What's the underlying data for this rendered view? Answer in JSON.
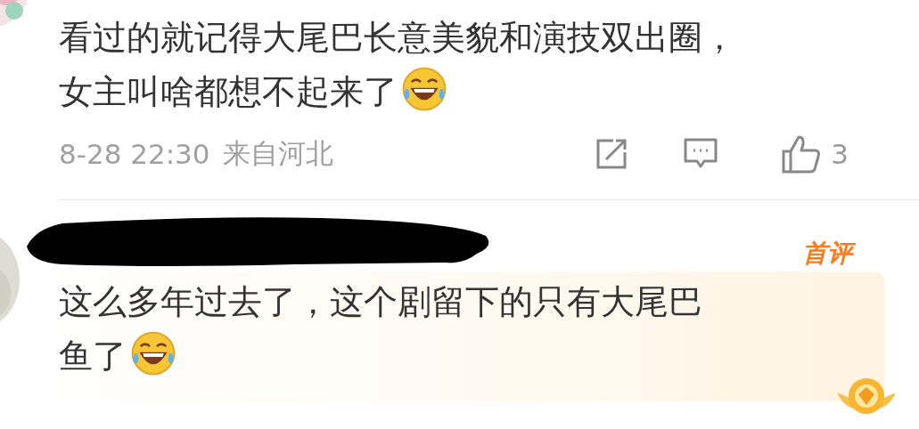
{
  "comments": [
    {
      "lines": [
        "看过的就记得大尾巴长意美貌和演技双出圈，",
        "女主叫啥都想不起来了"
      ],
      "time": "8-28 22:30",
      "location": "来自河北",
      "likes": "3"
    },
    {
      "badge": "首评",
      "lines": [
        "这么多年过去了，这个剧留下的只有大尾巴",
        "鱼了"
      ]
    }
  ]
}
